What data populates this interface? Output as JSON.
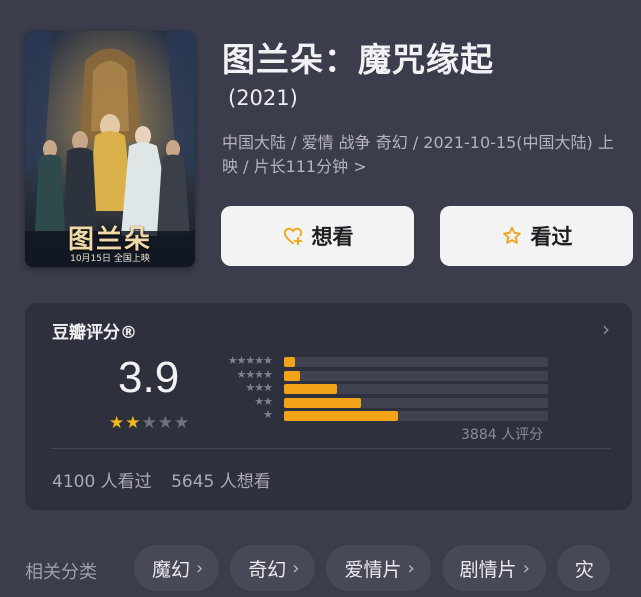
{
  "movie": {
    "title": "图兰朵：魔咒缘起",
    "year": "(2021)",
    "meta": "中国大陆 / 爱情 战争 奇幻 / 2021-10-15(中国大陆) 上映 / 片长111分钟 >",
    "poster": {
      "title_text": "图兰朵",
      "date_text": "10月15日 全国上映"
    }
  },
  "actions": {
    "want_label": "想看",
    "seen_label": "看过",
    "want_icon": "heart-plus-icon",
    "seen_icon": "star-outline-icon",
    "accent_color": "#f2a317"
  },
  "rating": {
    "title": "豆瓣评分®",
    "score": "3.9",
    "stars_filled": 2,
    "stars_total": 5,
    "distribution": [
      {
        "label": "★★★★★",
        "percent": 4
      },
      {
        "label": "★★★★",
        "percent": 6
      },
      {
        "label": "★★★",
        "percent": 20
      },
      {
        "label": "★★",
        "percent": 29
      },
      {
        "label": "★",
        "percent": 43
      }
    ],
    "count_text": "3884 人评分",
    "watched_text": "4100 人看过",
    "wish_text": "5645 人想看"
  },
  "tags": {
    "label": "相关分类",
    "items": [
      "魔幻",
      "奇幻",
      "爱情片",
      "剧情片",
      "灾"
    ]
  }
}
